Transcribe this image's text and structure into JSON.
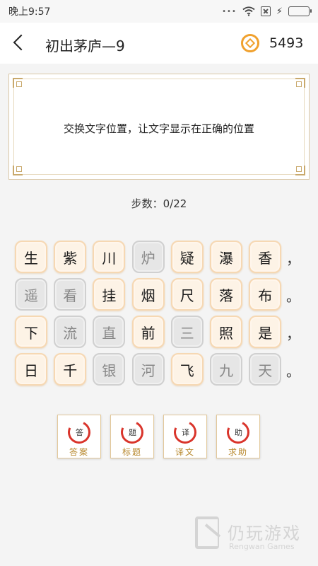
{
  "status_bar": {
    "time": "晚上9:57",
    "battery_color": "#33cc33"
  },
  "header": {
    "title": "初出茅庐—9",
    "coins": "5493",
    "coin_color": "#f0a12e"
  },
  "panel": {
    "instruction": "交换文字位置，让文字显示在正确的位置"
  },
  "steps": "步数：0/22",
  "grid": {
    "rows": [
      {
        "tiles": [
          {
            "char": "生",
            "state": "correct"
          },
          {
            "char": "紫",
            "state": "correct"
          },
          {
            "char": "川",
            "state": "correct"
          },
          {
            "char": "炉",
            "state": "wrong"
          },
          {
            "char": "疑",
            "state": "correct"
          },
          {
            "char": "瀑",
            "state": "correct"
          },
          {
            "char": "香",
            "state": "correct"
          }
        ],
        "punct": "，"
      },
      {
        "tiles": [
          {
            "char": "遥",
            "state": "wrong"
          },
          {
            "char": "看",
            "state": "wrong"
          },
          {
            "char": "挂",
            "state": "correct"
          },
          {
            "char": "烟",
            "state": "correct"
          },
          {
            "char": "尺",
            "state": "correct"
          },
          {
            "char": "落",
            "state": "correct"
          },
          {
            "char": "布",
            "state": "correct"
          }
        ],
        "punct": "。"
      },
      {
        "tiles": [
          {
            "char": "下",
            "state": "correct"
          },
          {
            "char": "流",
            "state": "wrong"
          },
          {
            "char": "直",
            "state": "wrong"
          },
          {
            "char": "前",
            "state": "correct"
          },
          {
            "char": "三",
            "state": "wrong"
          },
          {
            "char": "照",
            "state": "correct"
          },
          {
            "char": "是",
            "state": "correct"
          }
        ],
        "punct": "，"
      },
      {
        "tiles": [
          {
            "char": "日",
            "state": "correct"
          },
          {
            "char": "千",
            "state": "correct"
          },
          {
            "char": "银",
            "state": "wrong"
          },
          {
            "char": "河",
            "state": "wrong"
          },
          {
            "char": "飞",
            "state": "correct"
          },
          {
            "char": "九",
            "state": "wrong"
          },
          {
            "char": "天",
            "state": "wrong"
          }
        ],
        "punct": "。"
      }
    ]
  },
  "buttons": [
    {
      "name": "answer-button",
      "glyph": "答",
      "label": "答案"
    },
    {
      "name": "title-button",
      "glyph": "题",
      "label": "标题"
    },
    {
      "name": "translation-button",
      "glyph": "译",
      "label": "译文"
    },
    {
      "name": "help-button",
      "glyph": "助",
      "label": "求助"
    }
  ],
  "watermark": {
    "cn": "仍玩游戏",
    "en": "Rengwan Games"
  }
}
